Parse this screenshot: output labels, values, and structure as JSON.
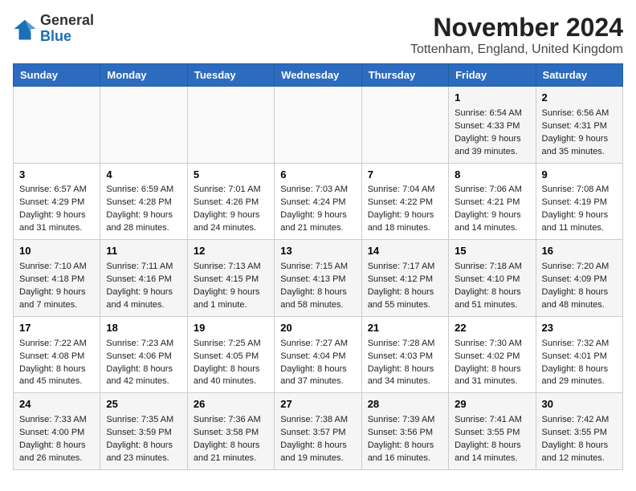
{
  "header": {
    "logo_general": "General",
    "logo_blue": "Blue",
    "month_title": "November 2024",
    "location": "Tottenham, England, United Kingdom"
  },
  "days_of_week": [
    "Sunday",
    "Monday",
    "Tuesday",
    "Wednesday",
    "Thursday",
    "Friday",
    "Saturday"
  ],
  "weeks": [
    [
      {
        "day": "",
        "info": ""
      },
      {
        "day": "",
        "info": ""
      },
      {
        "day": "",
        "info": ""
      },
      {
        "day": "",
        "info": ""
      },
      {
        "day": "",
        "info": ""
      },
      {
        "day": "1",
        "info": "Sunrise: 6:54 AM\nSunset: 4:33 PM\nDaylight: 9 hours and 39 minutes."
      },
      {
        "day": "2",
        "info": "Sunrise: 6:56 AM\nSunset: 4:31 PM\nDaylight: 9 hours and 35 minutes."
      }
    ],
    [
      {
        "day": "3",
        "info": "Sunrise: 6:57 AM\nSunset: 4:29 PM\nDaylight: 9 hours and 31 minutes."
      },
      {
        "day": "4",
        "info": "Sunrise: 6:59 AM\nSunset: 4:28 PM\nDaylight: 9 hours and 28 minutes."
      },
      {
        "day": "5",
        "info": "Sunrise: 7:01 AM\nSunset: 4:26 PM\nDaylight: 9 hours and 24 minutes."
      },
      {
        "day": "6",
        "info": "Sunrise: 7:03 AM\nSunset: 4:24 PM\nDaylight: 9 hours and 21 minutes."
      },
      {
        "day": "7",
        "info": "Sunrise: 7:04 AM\nSunset: 4:22 PM\nDaylight: 9 hours and 18 minutes."
      },
      {
        "day": "8",
        "info": "Sunrise: 7:06 AM\nSunset: 4:21 PM\nDaylight: 9 hours and 14 minutes."
      },
      {
        "day": "9",
        "info": "Sunrise: 7:08 AM\nSunset: 4:19 PM\nDaylight: 9 hours and 11 minutes."
      }
    ],
    [
      {
        "day": "10",
        "info": "Sunrise: 7:10 AM\nSunset: 4:18 PM\nDaylight: 9 hours and 7 minutes."
      },
      {
        "day": "11",
        "info": "Sunrise: 7:11 AM\nSunset: 4:16 PM\nDaylight: 9 hours and 4 minutes."
      },
      {
        "day": "12",
        "info": "Sunrise: 7:13 AM\nSunset: 4:15 PM\nDaylight: 9 hours and 1 minute."
      },
      {
        "day": "13",
        "info": "Sunrise: 7:15 AM\nSunset: 4:13 PM\nDaylight: 8 hours and 58 minutes."
      },
      {
        "day": "14",
        "info": "Sunrise: 7:17 AM\nSunset: 4:12 PM\nDaylight: 8 hours and 55 minutes."
      },
      {
        "day": "15",
        "info": "Sunrise: 7:18 AM\nSunset: 4:10 PM\nDaylight: 8 hours and 51 minutes."
      },
      {
        "day": "16",
        "info": "Sunrise: 7:20 AM\nSunset: 4:09 PM\nDaylight: 8 hours and 48 minutes."
      }
    ],
    [
      {
        "day": "17",
        "info": "Sunrise: 7:22 AM\nSunset: 4:08 PM\nDaylight: 8 hours and 45 minutes."
      },
      {
        "day": "18",
        "info": "Sunrise: 7:23 AM\nSunset: 4:06 PM\nDaylight: 8 hours and 42 minutes."
      },
      {
        "day": "19",
        "info": "Sunrise: 7:25 AM\nSunset: 4:05 PM\nDaylight: 8 hours and 40 minutes."
      },
      {
        "day": "20",
        "info": "Sunrise: 7:27 AM\nSunset: 4:04 PM\nDaylight: 8 hours and 37 minutes."
      },
      {
        "day": "21",
        "info": "Sunrise: 7:28 AM\nSunset: 4:03 PM\nDaylight: 8 hours and 34 minutes."
      },
      {
        "day": "22",
        "info": "Sunrise: 7:30 AM\nSunset: 4:02 PM\nDaylight: 8 hours and 31 minutes."
      },
      {
        "day": "23",
        "info": "Sunrise: 7:32 AM\nSunset: 4:01 PM\nDaylight: 8 hours and 29 minutes."
      }
    ],
    [
      {
        "day": "24",
        "info": "Sunrise: 7:33 AM\nSunset: 4:00 PM\nDaylight: 8 hours and 26 minutes."
      },
      {
        "day": "25",
        "info": "Sunrise: 7:35 AM\nSunset: 3:59 PM\nDaylight: 8 hours and 23 minutes."
      },
      {
        "day": "26",
        "info": "Sunrise: 7:36 AM\nSunset: 3:58 PM\nDaylight: 8 hours and 21 minutes."
      },
      {
        "day": "27",
        "info": "Sunrise: 7:38 AM\nSunset: 3:57 PM\nDaylight: 8 hours and 19 minutes."
      },
      {
        "day": "28",
        "info": "Sunrise: 7:39 AM\nSunset: 3:56 PM\nDaylight: 8 hours and 16 minutes."
      },
      {
        "day": "29",
        "info": "Sunrise: 7:41 AM\nSunset: 3:55 PM\nDaylight: 8 hours and 14 minutes."
      },
      {
        "day": "30",
        "info": "Sunrise: 7:42 AM\nSunset: 3:55 PM\nDaylight: 8 hours and 12 minutes."
      }
    ]
  ]
}
